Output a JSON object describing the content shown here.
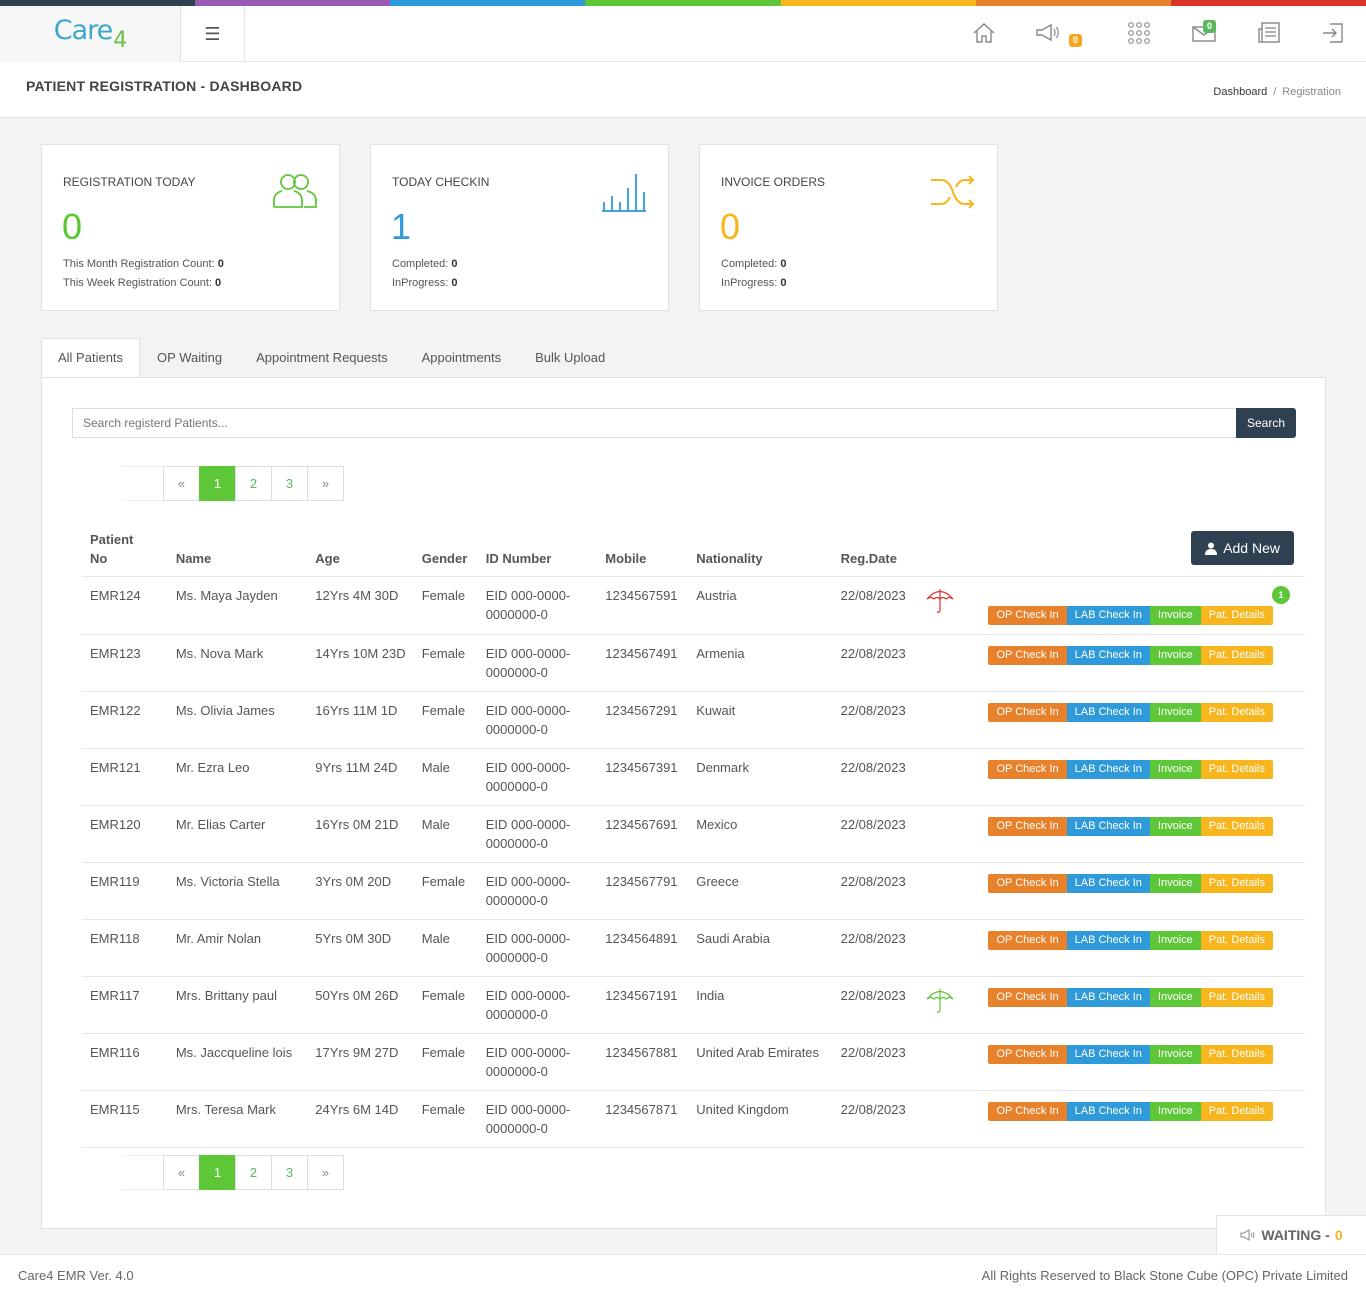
{
  "colors": {
    "topbar_segments": [
      "#2f4050",
      "#9b59b6",
      "#2f9ad9",
      "#5ec738",
      "#f7b51e",
      "#e8812b",
      "#d9352a"
    ],
    "registration": "#5ec738",
    "checkin": "#2f9ad9",
    "invoice": "#f7b51e",
    "primary_dark": "#2f4050"
  },
  "header": {
    "logo_text": "Care",
    "logo_suffix": "4",
    "menu_icon": "hamburger-icon",
    "icons": [
      "home-icon",
      "megaphone-icon",
      "apps-grid-icon",
      "mail-icon",
      "news-icon",
      "logout-icon"
    ],
    "announcements_count": "0",
    "mail_count": "0"
  },
  "page": {
    "title": "PATIENT REGISTRATION - DASHBOARD",
    "breadcrumb": [
      "Dashboard",
      "Registration"
    ],
    "breadcrumb_sep": "/"
  },
  "cards": [
    {
      "label": "REGISTRATION TODAY",
      "value": "0",
      "line1_label": "This Month Registration Count:",
      "line1_value": "0",
      "line2_label": "This Week Registration Count:",
      "line2_value": "0",
      "icon": "users-icon"
    },
    {
      "label": "TODAY CHECKIN",
      "value": "1",
      "line1_label": "Completed:",
      "line1_value": "0",
      "line2_label": "InProgress:",
      "line2_value": "0",
      "icon": "bar-chart-icon"
    },
    {
      "label": "INVOICE ORDERS",
      "value": "0",
      "line1_label": "Completed:",
      "line1_value": "0",
      "line2_label": "InProgress:",
      "line2_value": "0",
      "icon": "shuffle-icon"
    }
  ],
  "tabs": [
    "All Patients",
    "OP Waiting",
    "Appointment Requests",
    "Appointments",
    "Bulk Upload"
  ],
  "search": {
    "placeholder": "Search registerd Patients...",
    "button": "Search"
  },
  "pagination": {
    "prev": "«",
    "next": "»",
    "pages": [
      "1",
      "2",
      "3"
    ],
    "current": "1"
  },
  "add_new": "Add New",
  "table": {
    "headers": {
      "patient_no_1": "Patient",
      "patient_no_2": "No",
      "name": "Name",
      "age": "Age",
      "gender": "Gender",
      "id_number": "ID Number",
      "mobile": "Mobile",
      "nationality": "Nationality",
      "reg_date": "Reg.Date"
    },
    "action_labels": {
      "op": "OP Check In",
      "lab": "LAB Check In",
      "invoice": "Invoice",
      "details": "Pat. Details"
    },
    "rows": [
      {
        "no": "EMR124",
        "name": "Ms. Maya Jayden",
        "age": "12Yrs 4M 30D",
        "gender": "Female",
        "id1": "EID 000-0000-",
        "id2": "0000000-0",
        "mobile": "1234567591",
        "nationality": "Austria",
        "date": "22/08/2023",
        "insurance": "red",
        "notification": "1"
      },
      {
        "no": "EMR123",
        "name": "Ms. Nova Mark",
        "age": "14Yrs 10M 23D",
        "gender": "Female",
        "id1": "EID 000-0000-",
        "id2": "0000000-0",
        "mobile": "1234567491",
        "nationality": "Armenia",
        "date": "22/08/2023",
        "insurance": "",
        "notification": ""
      },
      {
        "no": "EMR122",
        "name": "Ms. Olivia James",
        "age": "16Yrs 11M 1D",
        "gender": "Female",
        "id1": "EID 000-0000-",
        "id2": "0000000-0",
        "mobile": "1234567291",
        "nationality": "Kuwait",
        "date": "22/08/2023",
        "insurance": "",
        "notification": ""
      },
      {
        "no": "EMR121",
        "name": "Mr. Ezra Leo",
        "age": "9Yrs 11M 24D",
        "gender": "Male",
        "id1": "EID 000-0000-",
        "id2": "0000000-0",
        "mobile": "1234567391",
        "nationality": "Denmark",
        "date": "22/08/2023",
        "insurance": "",
        "notification": ""
      },
      {
        "no": "EMR120",
        "name": "Mr. Elias Carter",
        "age": "16Yrs 0M 21D",
        "gender": "Male",
        "id1": "EID 000-0000-",
        "id2": "0000000-0",
        "mobile": "1234567691",
        "nationality": "Mexico",
        "date": "22/08/2023",
        "insurance": "",
        "notification": ""
      },
      {
        "no": "EMR119",
        "name": "Ms. Victoria Stella",
        "age": "3Yrs 0M 20D",
        "gender": "Female",
        "id1": "EID 000-0000-",
        "id2": "0000000-0",
        "mobile": "1234567791",
        "nationality": "Greece",
        "date": "22/08/2023",
        "insurance": "",
        "notification": ""
      },
      {
        "no": "EMR118",
        "name": "Mr. Amir Nolan",
        "age": "5Yrs 0M 30D",
        "gender": "Male",
        "id1": "EID 000-0000-",
        "id2": "0000000-0",
        "mobile": "1234564891",
        "nationality": "Saudi Arabia",
        "date": "22/08/2023",
        "insurance": "",
        "notification": ""
      },
      {
        "no": "EMR117",
        "name": "Mrs. Brittany paul",
        "age": "50Yrs 0M 26D",
        "gender": "Female",
        "id1": "EID 000-0000-",
        "id2": "0000000-0",
        "mobile": "1234567191",
        "nationality": "India",
        "date": "22/08/2023",
        "insurance": "green",
        "notification": ""
      },
      {
        "no": "EMR116",
        "name": "Ms. Jaccqueline lois",
        "age": "17Yrs 9M 27D",
        "gender": "Female",
        "id1": "EID 000-0000-",
        "id2": "0000000-0",
        "mobile": "1234567881",
        "nationality": "United Arab Emirates",
        "date": "22/08/2023",
        "insurance": "",
        "notification": ""
      },
      {
        "no": "EMR115",
        "name": "Mrs. Teresa Mark",
        "age": "24Yrs 6M 14D",
        "gender": "Female",
        "id1": "EID 000-0000-",
        "id2": "0000000-0",
        "mobile": "1234567871",
        "nationality": "United Kingdom",
        "date": "22/08/2023",
        "insurance": "",
        "notification": ""
      }
    ]
  },
  "waiting": {
    "label": "WAITING -",
    "count": "0"
  },
  "footer": {
    "version": "Care4 EMR Ver. 4.0",
    "rights": "All Rights Reserved to Black Stone Cube (OPC) Private Limited"
  }
}
